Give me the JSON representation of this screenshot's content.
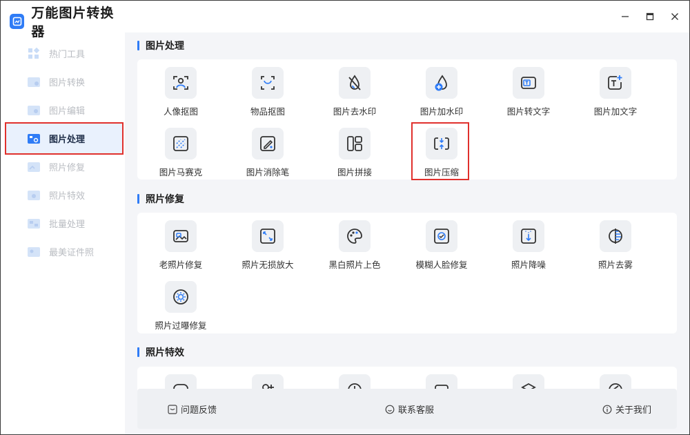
{
  "app": {
    "name": "万能图片转换器"
  },
  "sidebar": {
    "items": [
      {
        "label": "热门工具",
        "icon": "hot-tools-icon"
      },
      {
        "label": "图片转换",
        "icon": "image-convert-icon"
      },
      {
        "label": "图片编辑",
        "icon": "image-edit-icon"
      },
      {
        "label": "图片处理",
        "icon": "image-process-icon",
        "active": true
      },
      {
        "label": "照片修复",
        "icon": "photo-repair-icon"
      },
      {
        "label": "照片特效",
        "icon": "photo-effects-icon"
      },
      {
        "label": "批量处理",
        "icon": "batch-process-icon"
      },
      {
        "label": "最美证件照",
        "icon": "id-photo-icon"
      }
    ]
  },
  "sections": [
    {
      "title": "图片处理",
      "tools": [
        {
          "label": "人像抠图",
          "icon": "portrait-cutout-icon"
        },
        {
          "label": "物品抠图",
          "icon": "object-cutout-icon"
        },
        {
          "label": "图片去水印",
          "icon": "remove-watermark-icon"
        },
        {
          "label": "图片加水印",
          "icon": "add-watermark-icon"
        },
        {
          "label": "图片转文字",
          "icon": "image-to-text-icon"
        },
        {
          "label": "图片加文字",
          "icon": "add-text-icon"
        },
        {
          "label": "图片马赛克",
          "icon": "mosaic-icon"
        },
        {
          "label": "图片消除笔",
          "icon": "eraser-pen-icon"
        },
        {
          "label": "图片拼接",
          "icon": "collage-icon"
        },
        {
          "label": "图片压缩",
          "icon": "compress-icon",
          "highlighted": true
        }
      ]
    },
    {
      "title": "照片修复",
      "tools": [
        {
          "label": "老照片修复",
          "icon": "old-photo-icon"
        },
        {
          "label": "照片无损放大",
          "icon": "upscale-icon"
        },
        {
          "label": "黑白照片上色",
          "icon": "palette-icon"
        },
        {
          "label": "模糊人脸修复",
          "icon": "face-repair-icon"
        },
        {
          "label": "照片降噪",
          "icon": "denoise-icon"
        },
        {
          "label": "照片去雾",
          "icon": "dehaze-icon"
        },
        {
          "label": "照片过曝修复",
          "icon": "overexposure-icon"
        }
      ]
    },
    {
      "title": "照片特效",
      "tools": [
        {
          "icon": "effect-1-icon"
        },
        {
          "icon": "effect-2-icon"
        },
        {
          "icon": "effect-3-icon"
        },
        {
          "icon": "effect-4-icon"
        },
        {
          "icon": "effect-5-icon"
        },
        {
          "icon": "effect-6-icon"
        }
      ]
    }
  ],
  "footer": {
    "feedback": "问题反馈",
    "support": "联系客服",
    "about": "关于我们"
  },
  "colors": {
    "accent": "#2f7cf6",
    "highlight": "#e0302c"
  }
}
